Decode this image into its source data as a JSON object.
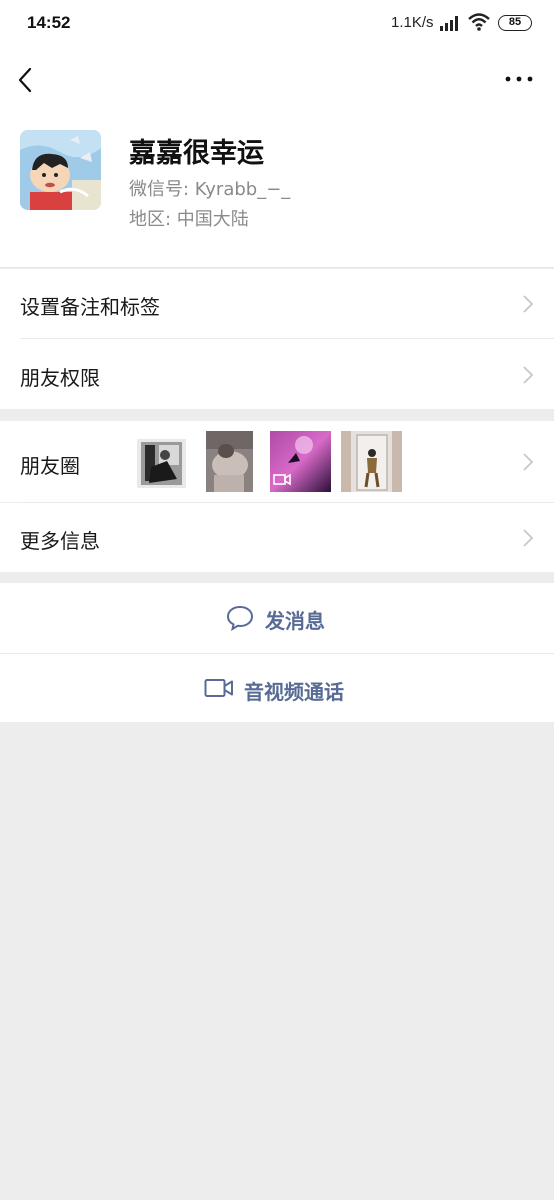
{
  "status_bar": {
    "time": "14:52",
    "net_speed": "1.1K/s",
    "battery": "85"
  },
  "profile": {
    "name": "嘉嘉很幸运",
    "wechat_id": "微信号: Kyrabb_−_",
    "region": "地区: 中国大陆"
  },
  "menu": {
    "remark_tags": "设置备注和标签",
    "friend_permissions": "朋友权限",
    "moments": "朋友圈",
    "more_info": "更多信息"
  },
  "actions": {
    "send_message": "发消息",
    "video_call": "音视频通话"
  },
  "colors": {
    "link_blue": "#576b95",
    "separator_gray": "#ededed",
    "secondary_text": "#8a8a8a"
  },
  "icons": {
    "back": "back-chevron-icon",
    "more": "more-dots-icon",
    "chat": "chat-bubble-icon",
    "video": "video-camera-icon"
  }
}
